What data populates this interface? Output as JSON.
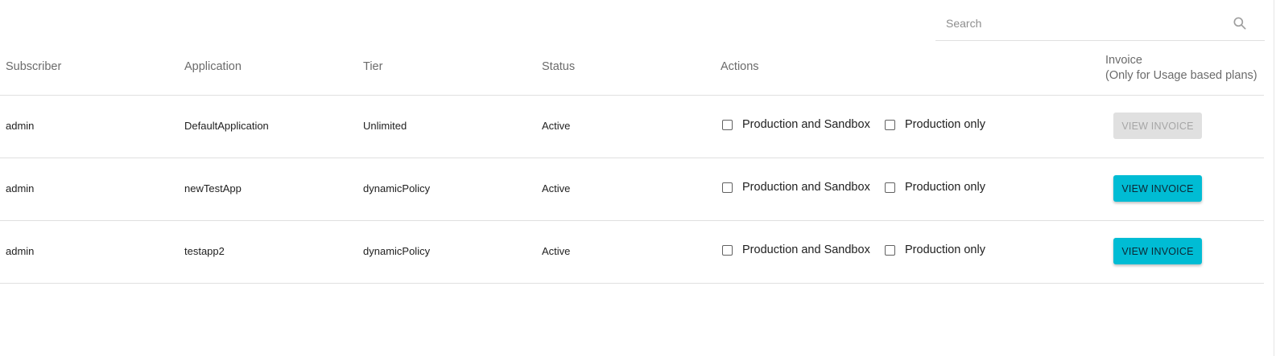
{
  "search": {
    "placeholder": "Search",
    "value": ""
  },
  "columns": {
    "subscriber": "Subscriber",
    "application": "Application",
    "tier": "Tier",
    "status": "Status",
    "actions": "Actions",
    "invoice": "Invoice",
    "invoice_note": "(Only for Usage based plans)"
  },
  "rows": [
    {
      "subscriber": "admin",
      "application": "DefaultApplication",
      "tier": "Unlimited",
      "status": "Active",
      "action_prod_sandbox": "Production and Sandbox",
      "action_prod_only": "Production only",
      "invoice_label": "VIEW INVOICE",
      "invoice_enabled": false
    },
    {
      "subscriber": "admin",
      "application": "newTestApp",
      "tier": "dynamicPolicy",
      "status": "Active",
      "action_prod_sandbox": "Production and Sandbox",
      "action_prod_only": "Production only",
      "invoice_label": "VIEW INVOICE",
      "invoice_enabled": true
    },
    {
      "subscriber": "admin",
      "application": "testapp2",
      "tier": "dynamicPolicy",
      "status": "Active",
      "action_prod_sandbox": "Production and Sandbox",
      "action_prod_only": "Production only",
      "invoice_label": "VIEW INVOICE",
      "invoice_enabled": true
    }
  ],
  "icons": {
    "search": "search-icon"
  },
  "colors": {
    "accent": "#00bcd4",
    "disabled_bg": "#e0e0e0",
    "disabled_text": "#a6a6a6"
  }
}
